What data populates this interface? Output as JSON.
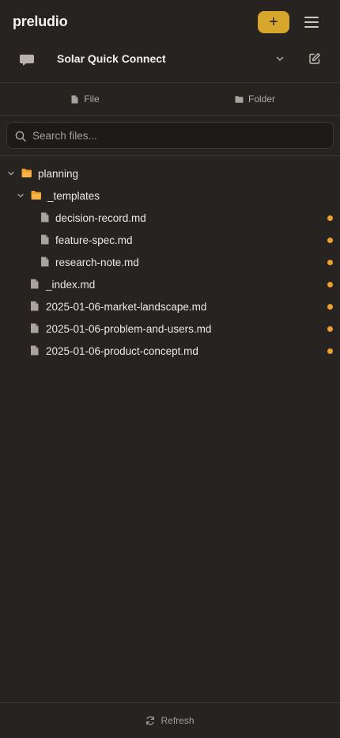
{
  "header": {
    "brand": "preludio",
    "add_label": "+",
    "accent": "#d6a62d"
  },
  "project": {
    "name": "Solar Quick Connect",
    "icons": [
      "chat-bubble-icon",
      "chevron-down-icon",
      "edit-icon"
    ]
  },
  "tabs": {
    "file_label": "File",
    "folder_label": "Folder"
  },
  "search": {
    "placeholder": "Search files..."
  },
  "tree": {
    "folders": [
      {
        "label": "planning",
        "expanded": true
      },
      {
        "label": "_templates",
        "expanded": true
      }
    ],
    "files": [
      {
        "label": "decision-record.md",
        "modified": true
      },
      {
        "label": "feature-spec.md",
        "modified": true
      },
      {
        "label": "research-note.md",
        "modified": true
      },
      {
        "label": "_index.md",
        "modified": true
      },
      {
        "label": "2025-01-06-market-landscape.md",
        "modified": true
      },
      {
        "label": "2025-01-06-problem-and-users.md",
        "modified": true
      },
      {
        "label": "2025-01-06-product-concept.md",
        "modified": true
      }
    ],
    "modified_color": "#f0a12b",
    "folder_color": "#f0a12b"
  },
  "footer": {
    "refresh_label": "Refresh"
  }
}
